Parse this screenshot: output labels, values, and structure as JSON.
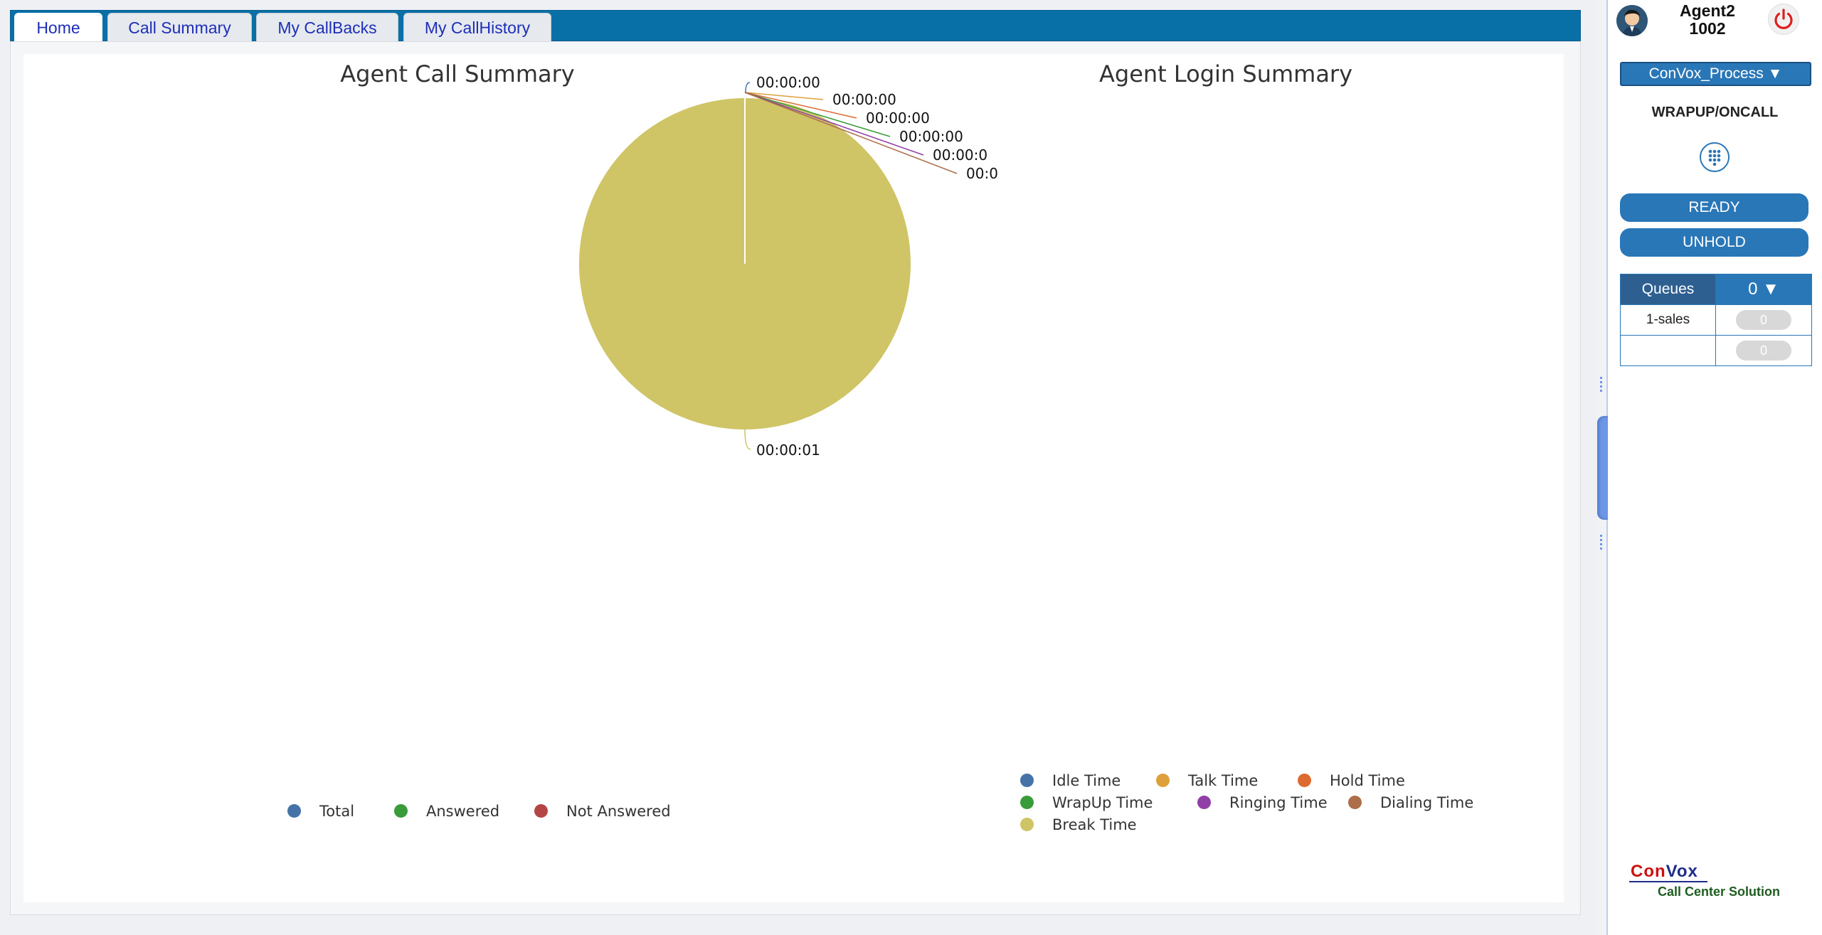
{
  "tabs": [
    {
      "label": "Home",
      "active": true
    },
    {
      "label": "Call Summary",
      "active": false
    },
    {
      "label": "My CallBacks",
      "active": false
    },
    {
      "label": "My CallHistory",
      "active": false
    }
  ],
  "call_chart": {
    "title": "Agent Call Summary",
    "legend": [
      {
        "label": "Total",
        "color": "#4572a7"
      },
      {
        "label": "Answered",
        "color": "#3a9b3a"
      },
      {
        "label": "Not Answered",
        "color": "#b54545"
      }
    ]
  },
  "chart_data": {
    "type": "pie",
    "title": "Agent Login Summary",
    "slices": [
      {
        "name": "Idle Time",
        "value": 0,
        "label": "00:00:00",
        "color": "#4572a7"
      },
      {
        "name": "Talk Time",
        "value": 0,
        "label": "00:00:00",
        "color": "#dea03a"
      },
      {
        "name": "Hold Time",
        "value": 0,
        "label": "00:00:00",
        "color": "#dd6a2e"
      },
      {
        "name": "WrapUp Time",
        "value": 0,
        "label": "00:00:00",
        "color": "#3a9b3a"
      },
      {
        "name": "Ringing Time",
        "value": 0,
        "label": "00:00:0",
        "color": "#8f3fa6"
      },
      {
        "name": "Dialing Time",
        "value": 0,
        "label": "00:0",
        "color": "#ad6e4a"
      },
      {
        "name": "Break Time",
        "value": 1,
        "label": "00:00:01",
        "color": "#cfc466"
      }
    ]
  },
  "agent": {
    "name": "Agent2",
    "extension": "1002"
  },
  "process": {
    "selected": "ConVox_Process ▼"
  },
  "status": "WRAPUP/ONCALL",
  "buttons": {
    "ready": "READY",
    "unhold": "UNHOLD"
  },
  "queues": {
    "header": "Queues",
    "count": "0 ▼",
    "rows": [
      {
        "name": "1-sales",
        "value": "0"
      },
      {
        "name": "",
        "value": "0"
      }
    ]
  },
  "brand": {
    "name_part1": "Con",
    "name_part2": "Vox",
    "tagline": "Call Center Solution",
    "color1": "#cc1111",
    "color2": "#1f2d8a"
  }
}
